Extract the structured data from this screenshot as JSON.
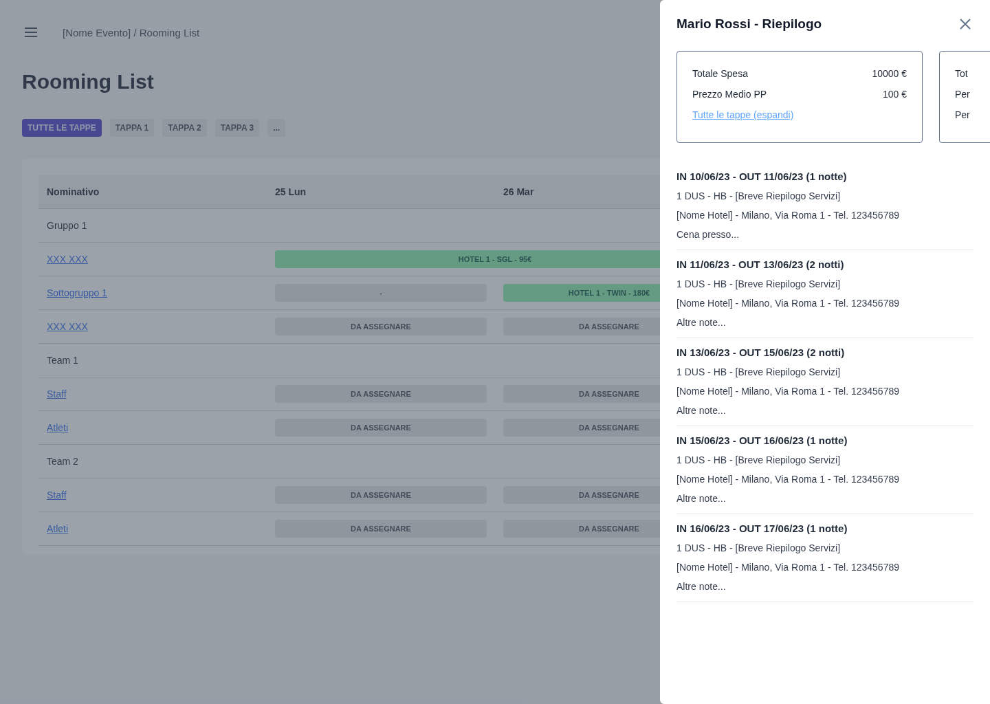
{
  "header": {
    "breadcrumb": "[Nome Evento] / Rooming List"
  },
  "page_title": "Rooming List",
  "tabs": [
    {
      "label": "TUTTE LE TAPPE",
      "selected": true
    },
    {
      "label": "TAPPA 1",
      "selected": false
    },
    {
      "label": "TAPPA 2",
      "selected": false
    },
    {
      "label": "TAPPA 3",
      "selected": false
    },
    {
      "label": "...",
      "selected": false
    }
  ],
  "table": {
    "columns": [
      "Nominativo",
      "25 Lun",
      "26 Mar"
    ],
    "rows": [
      {
        "kind": "group",
        "name": "Gruppo 1"
      },
      {
        "kind": "entry",
        "name": "XXX XXX",
        "cells": [
          {
            "kind": "booked",
            "text": "HOTEL 1 - SGL - 95€",
            "wide": true
          }
        ]
      },
      {
        "kind": "entry",
        "name": "Sottogruppo 1",
        "cells": [
          {
            "kind": "empty",
            "text": "-",
            "wide": false
          },
          {
            "kind": "booked",
            "text": "HOTEL 1 - TWIN - 180€",
            "wide": false
          }
        ]
      },
      {
        "kind": "entry",
        "name": "XXX XXX",
        "cells": [
          {
            "kind": "unassigned",
            "text": "DA ASSEGNARE",
            "wide": false
          },
          {
            "kind": "unassigned",
            "text": "DA ASSEGNARE",
            "wide": false
          }
        ]
      },
      {
        "kind": "group",
        "name": "Team 1"
      },
      {
        "kind": "entry",
        "name": "Staff",
        "cells": [
          {
            "kind": "unassigned",
            "text": "DA ASSEGNARE",
            "wide": false
          },
          {
            "kind": "unassigned",
            "text": "DA ASSEGNARE",
            "wide": false
          }
        ]
      },
      {
        "kind": "entry",
        "name": "Atleti",
        "cells": [
          {
            "kind": "unassigned",
            "text": "DA ASSEGNARE",
            "wide": false
          },
          {
            "kind": "unassigned",
            "text": "DA ASSEGNARE",
            "wide": false
          }
        ]
      },
      {
        "kind": "group",
        "name": "Team 2"
      },
      {
        "kind": "entry",
        "name": "Staff",
        "cells": [
          {
            "kind": "unassigned",
            "text": "DA ASSEGNARE",
            "wide": false
          },
          {
            "kind": "unassigned",
            "text": "DA ASSEGNARE",
            "wide": false
          }
        ]
      },
      {
        "kind": "entry",
        "name": "Atleti",
        "cells": [
          {
            "kind": "unassigned",
            "text": "DA ASSEGNARE",
            "wide": false
          },
          {
            "kind": "unassigned",
            "text": "DA ASSEGNARE",
            "wide": false
          }
        ]
      }
    ]
  },
  "drawer": {
    "title": "Mario Rossi - Riepilogo",
    "summary_cards": [
      {
        "rows": [
          {
            "label": "Totale Spesa",
            "value": "10000 €"
          },
          {
            "label": "Prezzo Medio PP",
            "value": "100 €"
          }
        ],
        "link": "Tutte le tappe (espandi)"
      },
      {
        "rows": [
          {
            "label": "Tot"
          },
          {
            "label": "Per"
          },
          {
            "label": "Per"
          }
        ]
      }
    ],
    "stays": [
      {
        "dates": "IN 10/06/23 - OUT 11/06/23 (1 notte)",
        "service": "1 DUS - HB - [Breve Riepilogo Servizi]",
        "hotel": "[Nome Hotel] - Milano, Via Roma 1 - Tel. 123456789",
        "note": "Cena presso..."
      },
      {
        "dates": "IN 11/06/23 - OUT 13/06/23 (2 notti)",
        "service": "1 DUS - HB - [Breve Riepilogo Servizi]",
        "hotel": "[Nome Hotel] - Milano, Via Roma 1 - Tel. 123456789",
        "note": "Altre note..."
      },
      {
        "dates": "IN 13/06/23 - OUT 15/06/23 (2 notti)",
        "service": "1 DUS - HB - [Breve Riepilogo Servizi]",
        "hotel": "[Nome Hotel] - Milano, Via Roma 1 - Tel. 123456789",
        "note": "Altre note..."
      },
      {
        "dates": "IN 15/06/23 - OUT 16/06/23 (1 notte)",
        "service": "1 DUS - HB - [Breve Riepilogo Servizi]",
        "hotel": "[Nome Hotel] - Milano, Via Roma 1 - Tel. 123456789",
        "note": "Altre note..."
      },
      {
        "dates": "IN 16/06/23 - OUT 17/06/23 (1 notte)",
        "service": "1 DUS - HB - [Breve Riepilogo Servizi]",
        "hotel": "[Nome Hotel] - Milano, Via Roma 1 - Tel. 123456789",
        "note": "Altre note..."
      }
    ]
  }
}
